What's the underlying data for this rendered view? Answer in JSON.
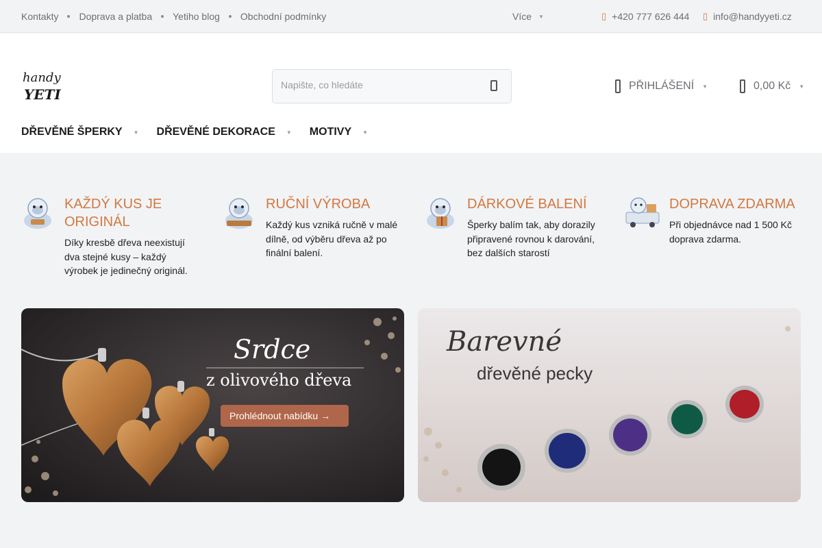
{
  "topbar": {
    "links": [
      "Kontakty",
      "Doprava a platba",
      "Yetiho blog",
      "Obchodní podmínky"
    ],
    "more": "Více",
    "phone": "+420 777 626 444",
    "email": "info@handyyeti.cz"
  },
  "header": {
    "logo_text": [
      "handy",
      "YETI"
    ],
    "search_placeholder": "Napište, co hledáte",
    "login": "PŘIHLÁŠENÍ",
    "cart_total": "0,00 Kč"
  },
  "nav": [
    "DŘEVĚNÉ ŠPERKY",
    "DŘEVĚNÉ DEKORACE",
    "MOTIVY"
  ],
  "features": [
    {
      "title": "KAŽDÝ KUS JE ORIGINÁL",
      "text": "Díky kresbě dřeva neexistují dva stejné kusy – každý výrobek je jedinečný originál."
    },
    {
      "title": "RUČNÍ VÝROBA",
      "text": "Každý kus vzniká ručně v malé dílně, od výběru dřeva až po finální balení."
    },
    {
      "title": "DÁRKOVÉ BALENÍ",
      "text": "Šperky balím tak, aby dorazily připravené rovnou k darování, bez dalších starostí"
    },
    {
      "title": "DOPRAVA ZDARMA",
      "text": "Při objednávce nad 1 500 Kč doprava zdarma."
    }
  ],
  "banners": {
    "left": {
      "title": "Srdce",
      "subtitle": "z olivového dřeva",
      "button": "Prohlédnout nabídku →"
    },
    "right": {
      "title": "Barevné",
      "subtitle": "dřevěné pecky"
    }
  },
  "colors": {
    "accent": "#d2783f",
    "button": "#b0664a"
  }
}
